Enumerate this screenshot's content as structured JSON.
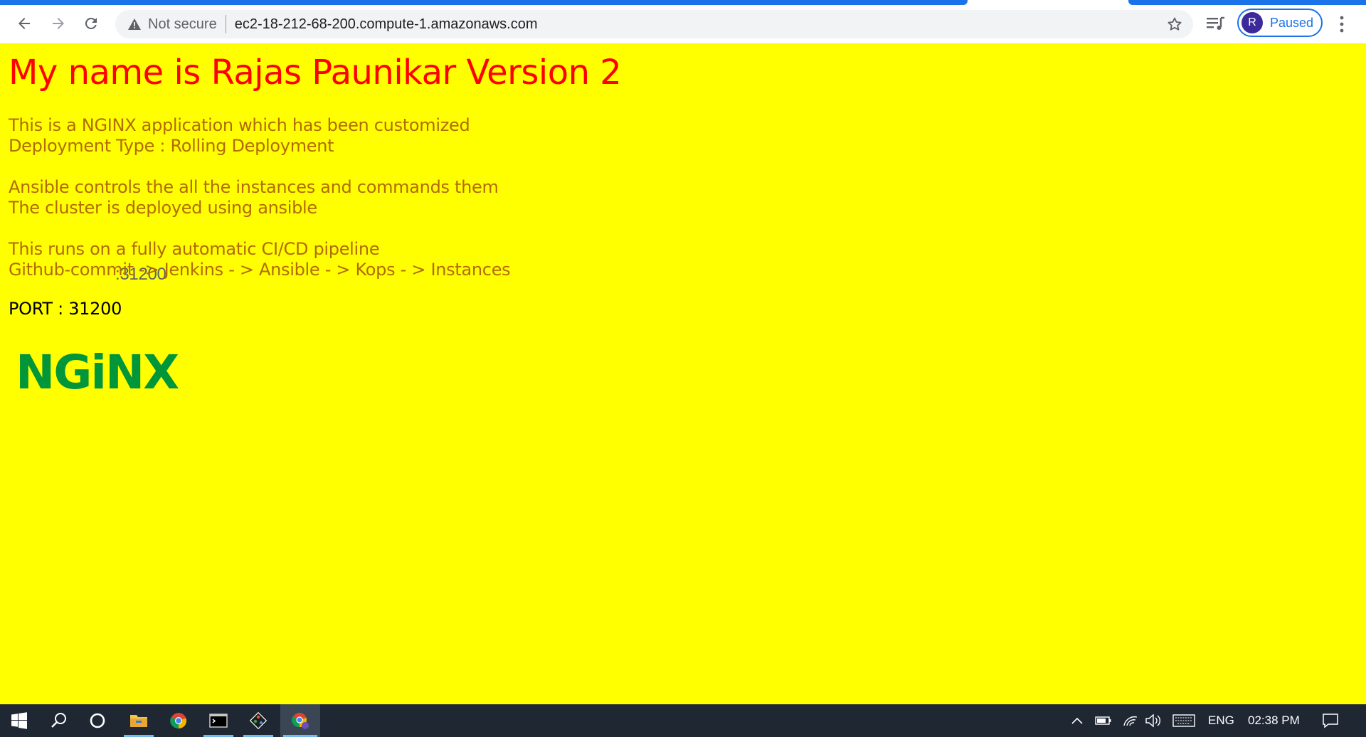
{
  "browser": {
    "security_label": "Not secure",
    "url_host": "ec2-18-212-68-200.compute-1.amazonaws.com",
    "url_port": ":31200",
    "profile_initial": "R",
    "profile_status": "Paused",
    "accent_color": "#1a73e8"
  },
  "page": {
    "background_color": "#ffff00",
    "title": "My name is Rajas Paunikar Version 2",
    "title_color": "#ff0000",
    "text_color": "#b36b00",
    "paragraphs": [
      [
        "This is a NGINX application which has been customized",
        "Deployment Type : Rolling Deployment"
      ],
      [
        "Ansible controls the all the instances and commands them",
        "The cluster is deployed using ansible"
      ],
      [
        "This runs on a fully automatic CI/CD pipeline",
        "Github-commit -> Jenkins - > Ansible - > Kops - > Instances"
      ]
    ],
    "port_line": "PORT : 31200",
    "logo_text": "NGiNX",
    "logo_color": "#009639"
  },
  "taskbar": {
    "language": "ENG",
    "time": "02:38 PM",
    "apps": [
      "start-icon",
      "search-icon",
      "cortana-icon",
      "file-explorer-icon",
      "chrome-icon",
      "terminal-icon",
      "git-icon",
      "chrome-profile-icon"
    ]
  }
}
